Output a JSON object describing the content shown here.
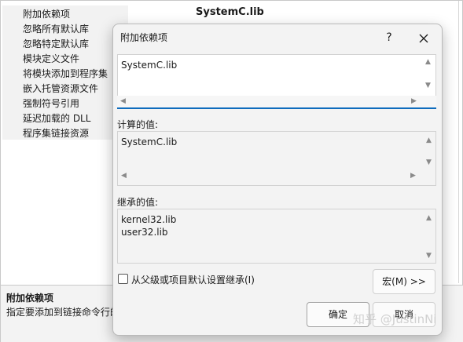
{
  "background": {
    "items": [
      "附加依赖项",
      "忽略所有默认库",
      "忽略特定默认库",
      "模块定义文件",
      "将模块添加到程序集",
      "嵌入托管资源文件",
      "强制符号引用",
      "延迟加载的 DLL",
      "程序集链接资源"
    ],
    "selected_value": "SystemC.lib",
    "description_title": "附加依赖项",
    "description_text": "指定要添加到链接命令行的"
  },
  "dialog": {
    "title": "附加依赖项",
    "help_label": "?",
    "edit_value": "SystemC.lib",
    "computed_label": "计算的值:",
    "computed_value": "SystemC.lib",
    "inherited_label": "继承的值:",
    "inherited_values": [
      "kernel32.lib",
      "user32.lib"
    ],
    "inherit_checkbox_label": "从父级或项目默认设置继承(I)",
    "inherit_checked": false,
    "macro_button": "宏(M) >>",
    "ok_button": "确定",
    "cancel_button": "取消",
    "accent_color": "#0f6cbd"
  },
  "watermark": "知乎 @JustinNi"
}
